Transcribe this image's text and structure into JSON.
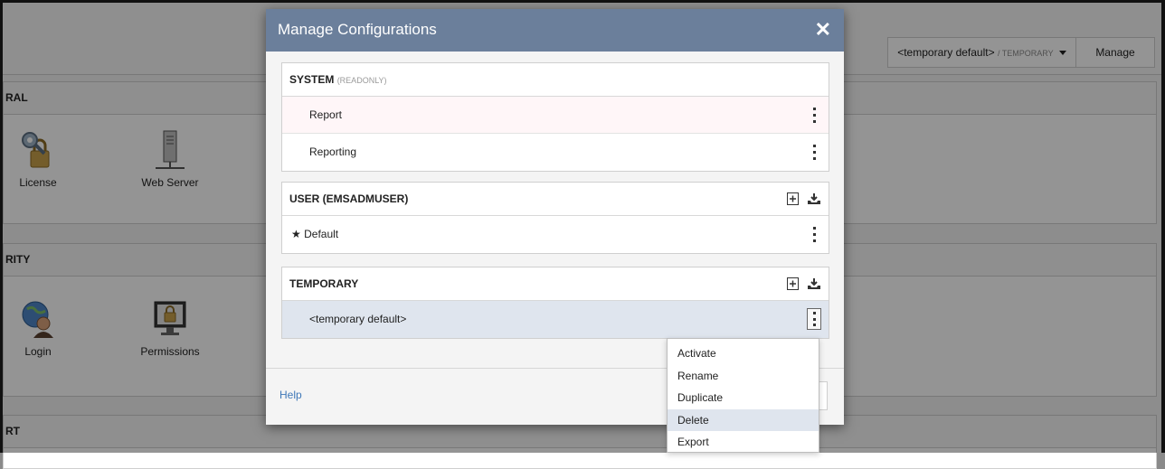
{
  "background": {
    "config_switch": {
      "name": "<temporary default>",
      "scope": "/ TEMPORARY"
    },
    "manage_label": "Manage",
    "sections": [
      {
        "title": "RAL",
        "tiles": [
          "License",
          "Web Server"
        ]
      },
      {
        "title": "RITY",
        "tiles": [
          "Login",
          "Permissions"
        ]
      },
      {
        "title": "RT"
      }
    ]
  },
  "modal": {
    "title": "Manage Configurations",
    "close_icon": "close-icon",
    "system": {
      "title": "SYSTEM",
      "note": "(READONLY)",
      "items": [
        "Report",
        "Reporting"
      ]
    },
    "user": {
      "title": "USER (EMSADMUSER)",
      "items": [
        "Default"
      ]
    },
    "temporary": {
      "title": "TEMPORARY",
      "items": [
        "<temporary default>"
      ]
    },
    "help_label": "Help"
  },
  "context_menu": {
    "items": [
      "Activate",
      "Rename",
      "Duplicate",
      "Delete",
      "Export"
    ],
    "highlighted": "Delete"
  },
  "colors": {
    "modal_header": "#6b7f9b",
    "selected_row": "#dfe5ee",
    "link": "#3f78b8"
  }
}
